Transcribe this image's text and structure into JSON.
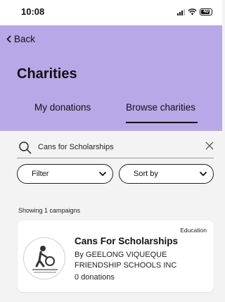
{
  "status_bar": {
    "time": "10:08",
    "battery_level": "40"
  },
  "header": {
    "back_label": "Back",
    "title": "Charities",
    "background_color": "#b9a8e8",
    "tabs": [
      {
        "label": "My donations",
        "selected": false
      },
      {
        "label": "Browse charities",
        "selected": true
      }
    ]
  },
  "search": {
    "value": "Cans for Scholarships"
  },
  "filters": {
    "filter_label": "Filter",
    "sort_label": "Sort by"
  },
  "results": {
    "summary": "Showing 1 campaigns",
    "campaigns": [
      {
        "category": "Education",
        "title": "Cans For Scholarships",
        "organization": "By GEELONG VIQUEQUE FRIENDSHIP SCHOOLS INC",
        "donations": "0 donations"
      }
    ]
  }
}
